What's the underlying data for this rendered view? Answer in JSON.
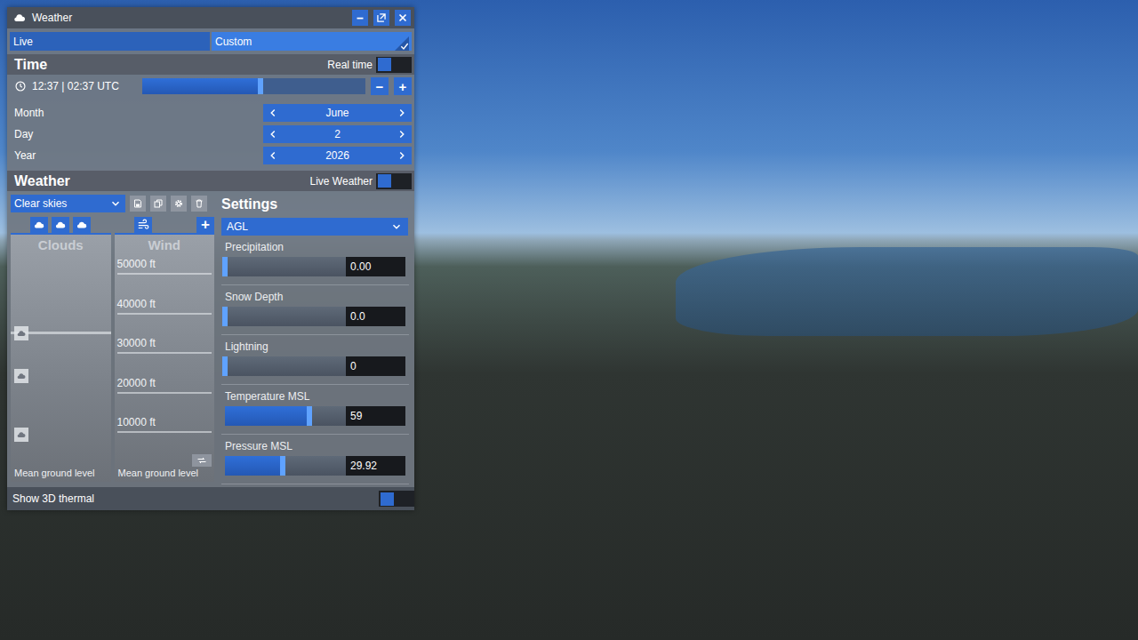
{
  "window": {
    "title": "Weather"
  },
  "tabs": [
    {
      "label": "Live",
      "selected": false
    },
    {
      "label": "Custom",
      "selected": true
    }
  ],
  "time": {
    "title": "Time",
    "real_time": {
      "label": "Real time",
      "on": false
    },
    "clock": "12:37 | 02:37 UTC",
    "level": 0.53,
    "decrement": "−",
    "increment": "+",
    "fields": [
      {
        "label": "Month",
        "value": "June"
      },
      {
        "label": "Day",
        "value": "2"
      },
      {
        "label": "Year",
        "value": "2026"
      }
    ]
  },
  "weather": {
    "title": "Weather",
    "live_weather": {
      "label": "Live Weather",
      "on": false
    },
    "preset": "Clear skies",
    "add_layer": "+",
    "clouds": {
      "title": "Clouds",
      "ground": "Mean ground level",
      "layers": [
        {
          "level": 0.6,
          "selected": true
        },
        {
          "level": 0.4,
          "selected": false
        },
        {
          "level": 0.12,
          "selected": false
        }
      ]
    },
    "wind": {
      "title": "Wind",
      "ground": "Mean ground level",
      "altitudes": [
        "50000 ft",
        "40000 ft",
        "30000 ft",
        "20000 ft",
        "10000 ft"
      ]
    },
    "settings": {
      "title": "Settings",
      "reference": "AGL",
      "rows": [
        {
          "label": "Precipitation",
          "value": "0.00",
          "level": 0
        },
        {
          "label": "Snow Depth",
          "value": "0.0",
          "level": 0
        },
        {
          "label": "Lightning",
          "value": "0",
          "level": 0
        },
        {
          "label": "Temperature MSL",
          "value": "59",
          "level": 0.7
        },
        {
          "label": "Pressure MSL",
          "value": "29.92",
          "level": 0.48
        }
      ]
    },
    "thermal": {
      "label": "Show 3D thermal",
      "on": false
    }
  }
}
